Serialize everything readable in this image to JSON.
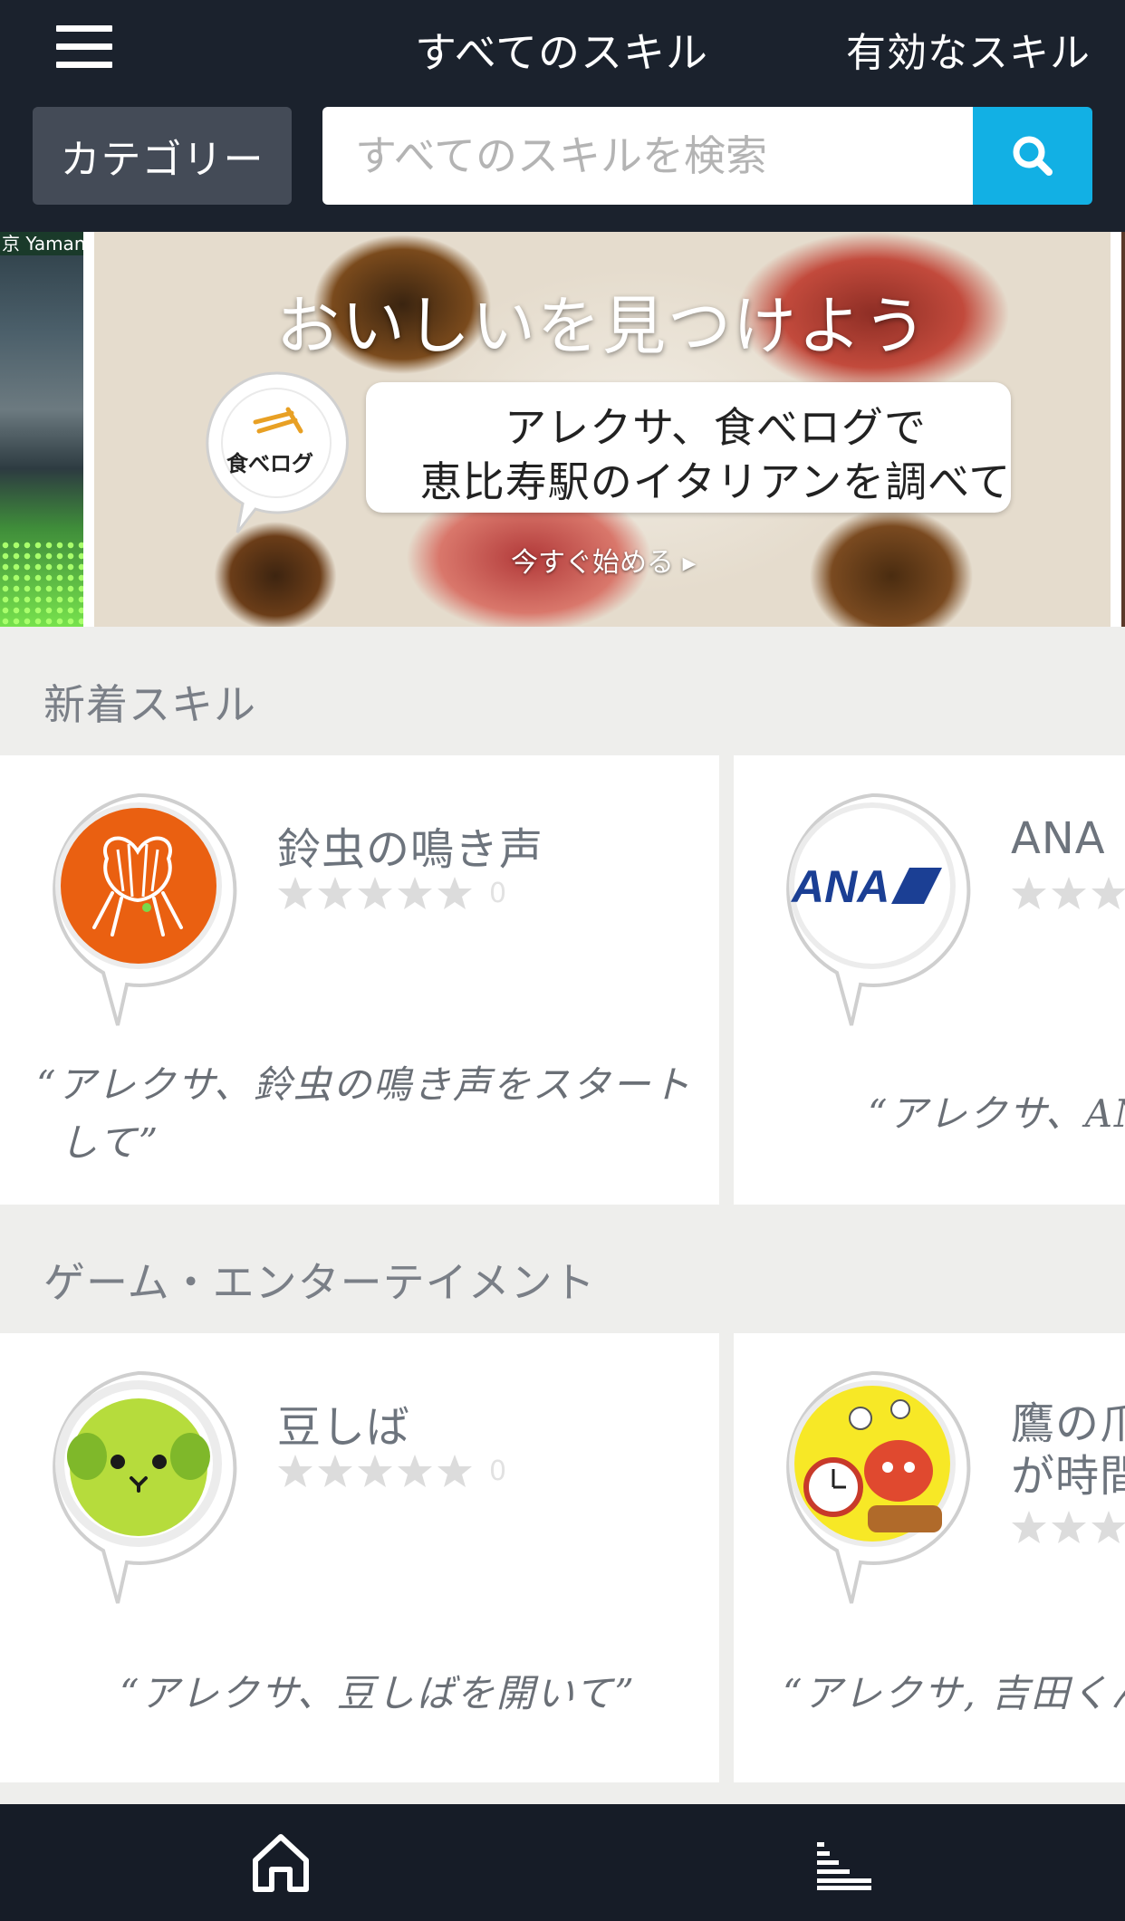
{
  "header": {
    "tab_all": "すべてのスキル",
    "tab_enabled": "有効なスキル",
    "category_label": "カテゴリー",
    "search_placeholder": "すべてのスキルを検索"
  },
  "banner": {
    "side_label": "京 Yamanot",
    "title": "おいしいを見つけよう",
    "bubble_line1": "アレクサ、食べログで",
    "bubble_line2": "恵比寿駅のイタリアンを調べて",
    "cta": "今すぐ始める ▸",
    "logo_text": "食べログ"
  },
  "sections": [
    {
      "title": "新着スキル",
      "cards": [
        {
          "name": "鈴虫の鳴き声",
          "rating": 0,
          "rating_count": "0",
          "utterance_line1": "“アレクサ、鈴虫の鳴き声をスタート",
          "utterance_line2": "して”",
          "icon": "cricket-icon",
          "icon_color": "#ea6011"
        },
        {
          "name": "ANA",
          "utterance_line1": "“アレクサ、AN",
          "icon": "ana-logo-icon",
          "icon_color": "#1b3f94"
        }
      ]
    },
    {
      "title": "ゲーム・エンターテイメント",
      "cards": [
        {
          "name": "豆しば",
          "rating": 0,
          "rating_count": "0",
          "utterance_line1": "“アレクサ、豆しばを開いて”",
          "icon": "mameshiba-icon",
          "icon_color": "#b6dc3c"
        },
        {
          "name_line1": "鷹の爪",
          "name_line2": "が時間",
          "utterance_line1": "“アレクサ, 吉田くん",
          "icon": "alarm-clock-character-icon",
          "icon_color": "#f7e826"
        }
      ]
    }
  ],
  "bottom_nav": {
    "home_icon": "home-icon",
    "list_icon": "activity-list-icon"
  },
  "colors": {
    "topbar": "#1b222d",
    "search_button": "#12b0e4",
    "star_empty": "#dcdcdc",
    "page_bg": "#eeeeec"
  }
}
